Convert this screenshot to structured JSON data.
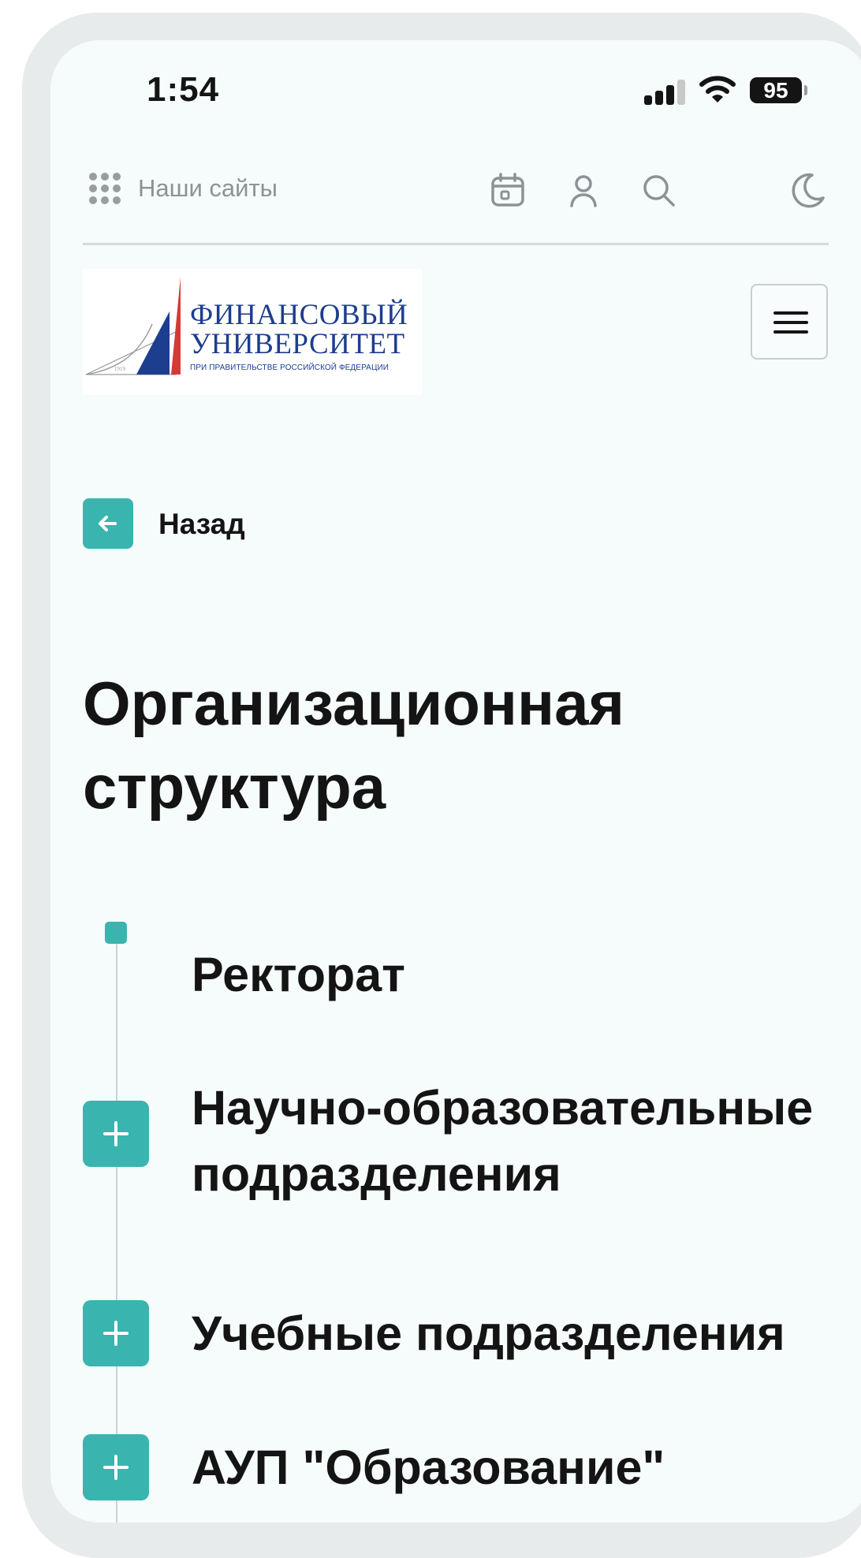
{
  "status_bar": {
    "time": "1:54",
    "battery": "95"
  },
  "top_bar": {
    "sites_label": "Наши сайты"
  },
  "logo": {
    "line1": "ФИНАНСОВЫЙ",
    "line2": "УНИВЕРСИТЕТ",
    "line3": "ПРИ ПРАВИТЕЛЬСТВЕ РОССИЙСКОЙ ФЕДЕРАЦИИ",
    "year": "1919",
    "colors": {
      "blue": "#1d3d8f",
      "red": "#d63a36"
    }
  },
  "back": {
    "label": "Назад"
  },
  "page_title": "Организационная структура",
  "structure": {
    "items": [
      {
        "label": "Ректорат",
        "expandable": false
      },
      {
        "label": "Научно-образовательные подразделения",
        "expandable": true
      },
      {
        "label": "Учебные подразделения",
        "expandable": true
      },
      {
        "label": "АУП \"Образование\"",
        "expandable": true
      }
    ]
  },
  "colors": {
    "accent": "#3ab4ae",
    "background": "#f6fbfb",
    "text": "#141414"
  }
}
